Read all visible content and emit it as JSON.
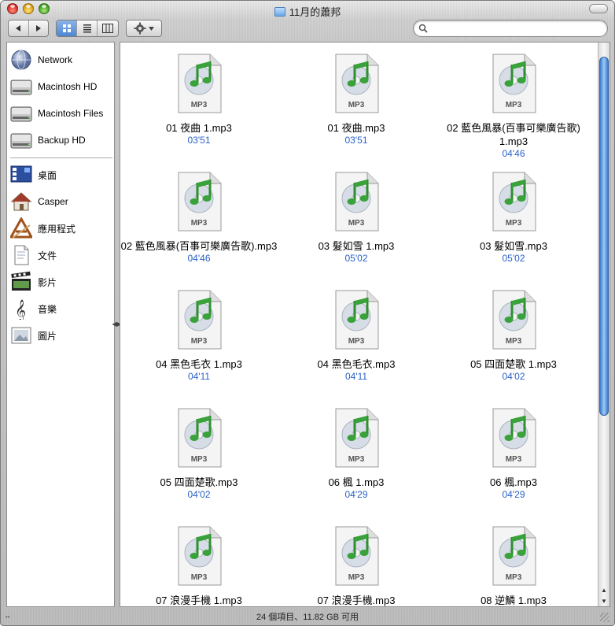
{
  "window": {
    "title": "11月的蕭邦"
  },
  "toolbar": {
    "back_icon": "back-arrow-icon",
    "forward_icon": "forward-arrow-icon",
    "view_modes": [
      "icon-view-icon",
      "list-view-icon",
      "column-view-icon"
    ],
    "active_view": "icon-view",
    "action_icon": "gear-icon",
    "search_value": ""
  },
  "sidebar": {
    "devices": [
      {
        "label": "Network",
        "icon": "network-globe-icon"
      },
      {
        "label": "Macintosh HD",
        "icon": "hard-disk-icon"
      },
      {
        "label": "Macintosh Files",
        "icon": "hard-disk-icon"
      },
      {
        "label": "Backup HD",
        "icon": "hard-disk-icon"
      }
    ],
    "places": [
      {
        "label": "桌面",
        "icon": "desktop-icon"
      },
      {
        "label": "Casper",
        "icon": "home-icon"
      },
      {
        "label": "應用程式",
        "icon": "applications-icon"
      },
      {
        "label": "文件",
        "icon": "documents-icon"
      },
      {
        "label": "影片",
        "icon": "movies-icon"
      },
      {
        "label": "音樂",
        "icon": "music-icon"
      },
      {
        "label": "圖片",
        "icon": "pictures-icon"
      }
    ]
  },
  "files": [
    {
      "name": "01 夜曲 1.mp3",
      "duration": "03'51"
    },
    {
      "name": "01 夜曲.mp3",
      "duration": "03'51"
    },
    {
      "name": "02 藍色風暴(百事可樂廣告歌) 1.mp3",
      "duration": "04'46"
    },
    {
      "name": "02 藍色風暴(百事可樂廣告歌).mp3",
      "duration": "04'46"
    },
    {
      "name": "03 髮如雪 1.mp3",
      "duration": "05'02"
    },
    {
      "name": "03 髮如雪.mp3",
      "duration": "05'02"
    },
    {
      "name": "04 黑色毛衣 1.mp3",
      "duration": "04'11"
    },
    {
      "name": "04 黑色毛衣.mp3",
      "duration": "04'11"
    },
    {
      "name": "05 四面楚歌 1.mp3",
      "duration": "04'02"
    },
    {
      "name": "05 四面楚歌.mp3",
      "duration": "04'02"
    },
    {
      "name": "06 楓 1.mp3",
      "duration": "04'29"
    },
    {
      "name": "06 楓.mp3",
      "duration": "04'29"
    },
    {
      "name": "07 浪漫手機 1.mp3",
      "duration": ""
    },
    {
      "name": "07 浪漫手機.mp3",
      "duration": ""
    },
    {
      "name": "08 逆鱗 1.mp3",
      "duration": ""
    }
  ],
  "file_badge": "MP3",
  "status": {
    "text": "24 個項目、11.82 GB 可用"
  },
  "colors": {
    "selection_blue": "#4d86d1",
    "duration_blue": "#2a62c5",
    "note_green": "#3aa23a"
  }
}
